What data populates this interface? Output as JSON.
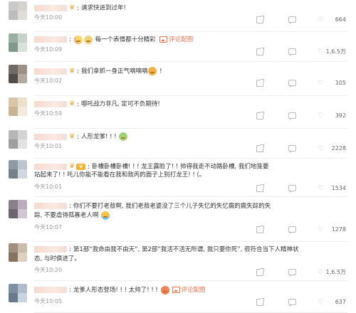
{
  "comments": [
    {
      "avatar_colors": [
        "#c9c9c9",
        "#d8d2cd",
        "#bdbdbd",
        "#e0dcd8"
      ],
      "badge": "crown",
      "segments": [
        {
          "t": "text",
          "v": "请求快进到过年!"
        }
      ],
      "time": "今天10:00",
      "likes": "664"
    },
    {
      "avatar_colors": [
        "#9ab0a0",
        "#c7d3c9",
        "#7f9a8a",
        "#d9e2da"
      ],
      "badge": "",
      "segments": [
        {
          "t": "emoji",
          "icon": "shy-face-emoji-icon",
          "style": "shy"
        },
        {
          "t": "emoji",
          "icon": "cute-face-emoji-icon",
          "style": "cute"
        },
        {
          "t": "text",
          "v": " 每一个表情都十分精彩 "
        },
        {
          "t": "imglink",
          "v": "评论配图"
        }
      ],
      "time": "今天10:09",
      "likes": "1,6.5万"
    },
    {
      "avatar_colors": [
        "#6f6a63",
        "#9c9084",
        "#514c47",
        "#b3aaa0"
      ],
      "badge": "crown",
      "segments": [
        {
          "t": "text",
          "v": "我们拿抓一身正气嘀嘀嘀"
        },
        {
          "t": "emoji",
          "icon": "grin-emoji-icon",
          "style": "wow"
        },
        {
          "t": "text",
          "v": " !"
        }
      ],
      "time": "今天10:02",
      "likes": "105"
    },
    {
      "avatar_colors": [
        "#d9c6a8",
        "#ece0cc",
        "#c8b493",
        "#f3eadb"
      ],
      "badge": "crown",
      "segments": [
        {
          "t": "text",
          "v": "哪吒战力非凡, 定可不负期待!"
        }
      ],
      "time": "今天10:59",
      "likes": "392"
    },
    {
      "avatar_colors": [
        "#b6b6b6",
        "#d4d4d4",
        "#9e9e9e",
        "#e2e2e2"
      ],
      "badge": "crown",
      "segments": [
        {
          "t": "text",
          "v": "人形龙爹! ! ! "
        },
        {
          "t": "emoji",
          "icon": "sick-face-emoji-icon",
          "style": "sick"
        }
      ],
      "time": "今天10:01",
      "likes": "2228"
    },
    {
      "avatar_colors": [
        "#8f9aa6",
        "#bcc5cd",
        "#76818c",
        "#d0d7dd"
      ],
      "badge": "vip",
      "segments": [
        {
          "t": "text",
          "v": "卧槽卧槽卧槽! ! ! 龙王露脸了! ! 帅得我走不动路卧槽, 我们地笼要"
        }
      ],
      "line2": "站起来了! ! 吒儿你能不能看在我和敖丙的面子上别打龙王! ! (。",
      "time": "今天10:01",
      "likes": "1534"
    },
    {
      "avatar_colors": [
        "#8a7f8d",
        "#b9adbb",
        "#6d6470",
        "#cfc6d1"
      ],
      "badge": "",
      "segments": [
        {
          "t": "text",
          "v": "你们不要打老敖啊, 我们老敖老婆没了三个儿子失忆的失忆瘸的瘸失踪的失"
        }
      ],
      "line2": "踪, 不要虐待孤寡老人啊 ",
      "line2_emoji": {
        "icon": "crying-emoji-icon",
        "style": "cry"
      },
      "time": "今天10:07",
      "likes": "1278"
    },
    {
      "avatar_colors": [
        "#a18f7d",
        "#c9bba9",
        "#85735f",
        "#ddd0c0"
      ],
      "badge": "",
      "segments": [
        {
          "t": "text",
          "v": "第1部“我命由我不由天”, 第2部“我活不活无所谓, 我只要你死”, 很符合当下人精神状"
        }
      ],
      "line2": "态, 与时俱进了。",
      "time": "今天10:20",
      "likes": "1,6.5万"
    },
    {
      "avatar_colors": [
        "#7f8fa3",
        "#aebccb",
        "#6a7a8e",
        "#c7d3df"
      ],
      "badge": "",
      "segments": [
        {
          "t": "text",
          "v": "龙爹人形态登场! ! ! 太帅了! ! ! "
        },
        {
          "t": "emoji",
          "icon": "love-face-emoji-icon",
          "style": "love"
        },
        {
          "t": "imglink",
          "v": "评论配图"
        }
      ],
      "time": "今天10:05",
      "likes": "637"
    }
  ],
  "icons": {
    "crown": "crown-badge-icon",
    "vip": "vip-badge-icon",
    "share": "share-icon",
    "reply": "reply-icon",
    "like": "thumb-up-icon"
  },
  "colors": {
    "link": "#eb7350",
    "time": "#999999",
    "badge": "#f0a020"
  }
}
